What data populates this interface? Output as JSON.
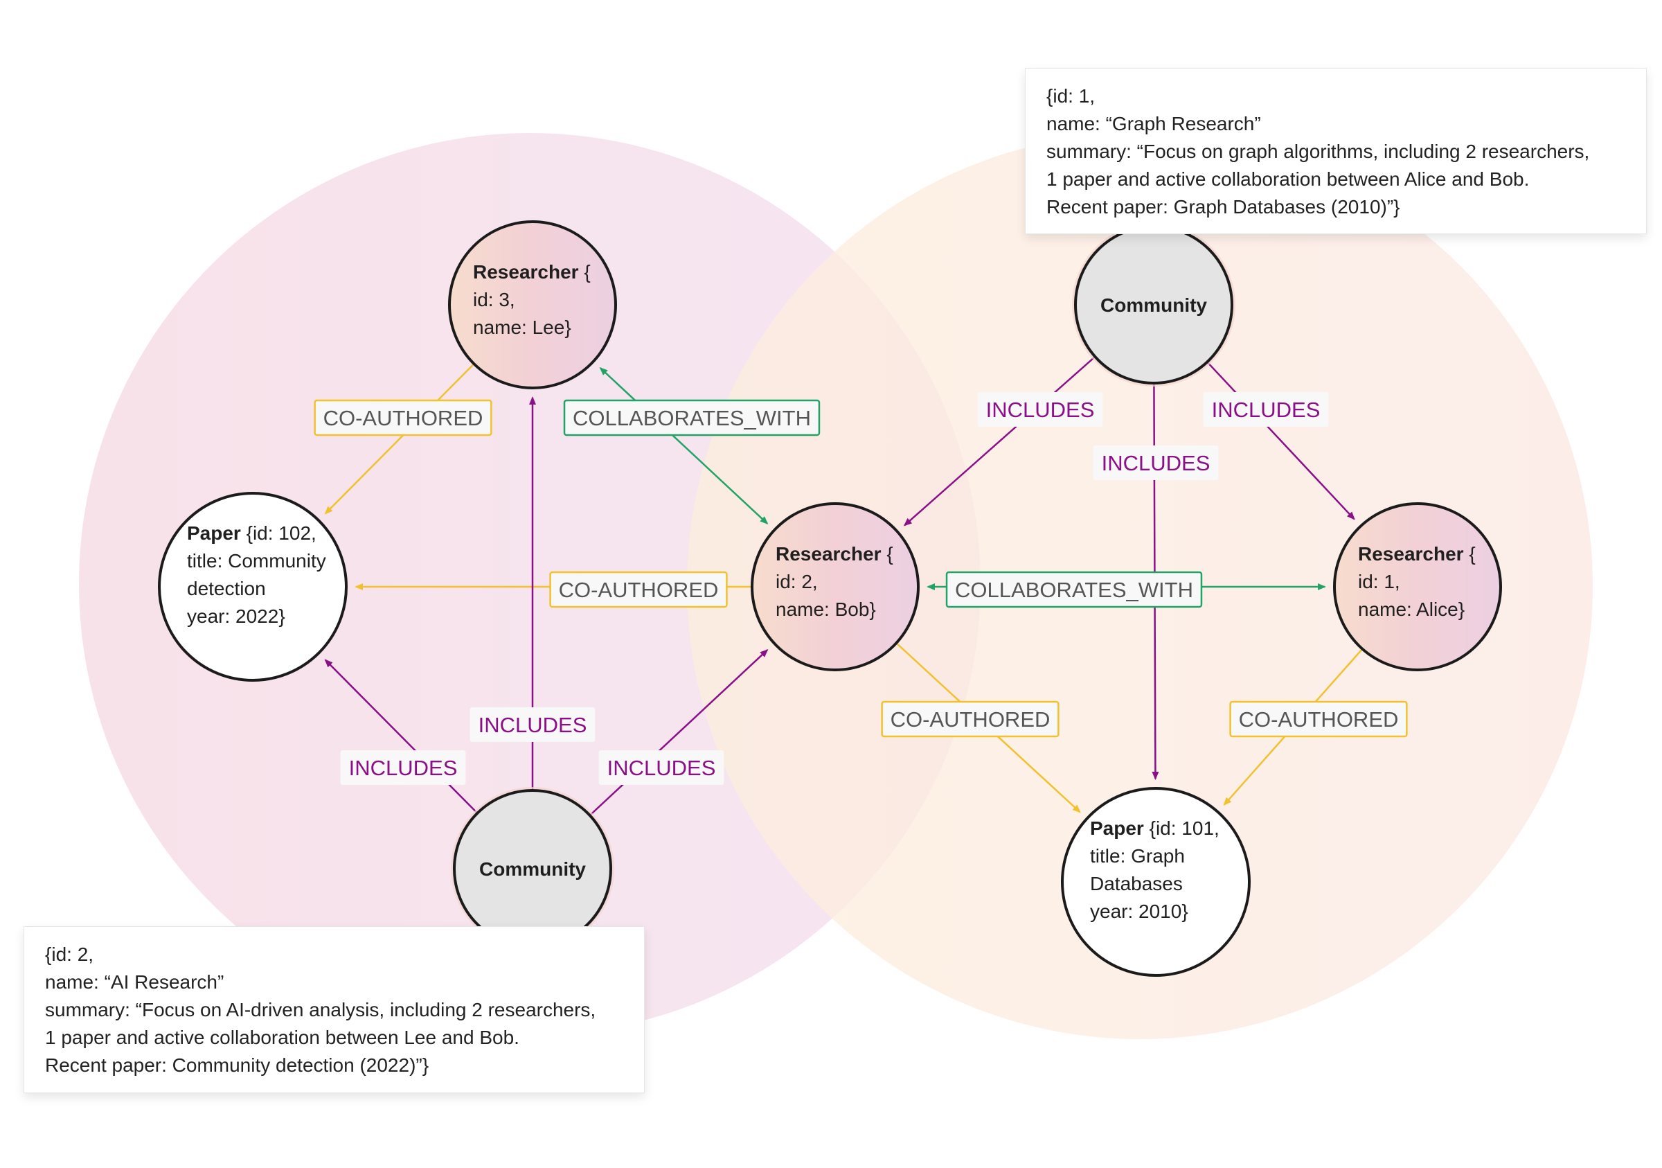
{
  "colors": {
    "includes": "#8b0f87",
    "co_authored": "#f2c12e",
    "collaborates_with": "#21a366",
    "node_stroke": "#1b1b1b",
    "community_fill": "#e4e4e4",
    "paper_fill": "#ffffff",
    "cluster_ai": "#f5d6e4",
    "cluster_graph": "#fde3cf",
    "label_text_gray": "#555555"
  },
  "clusters": [
    {
      "id": "ai",
      "name": "AI Research"
    },
    {
      "id": "graph",
      "name": "Graph Research"
    }
  ],
  "nodes": [
    {
      "id": "lee",
      "type": "researcher",
      "lines": [
        {
          "bold": "Researcher",
          "rest": " {"
        },
        {
          "bold": "",
          "rest": "id: 3,"
        },
        {
          "bold": "",
          "rest": "name: Lee}"
        }
      ]
    },
    {
      "id": "paper102",
      "type": "paper",
      "lines": [
        {
          "bold": "Paper",
          "rest": " {id: 102,"
        },
        {
          "bold": "",
          "rest": "title: Community"
        },
        {
          "bold": "",
          "rest": "detection"
        },
        {
          "bold": "",
          "rest": "year: 2022}"
        }
      ]
    },
    {
      "id": "bob",
      "type": "researcher",
      "lines": [
        {
          "bold": "Researcher",
          "rest": " {"
        },
        {
          "bold": "",
          "rest": "id: 2,"
        },
        {
          "bold": "",
          "rest": "name: Bob}"
        }
      ]
    },
    {
      "id": "community_ai",
      "type": "community",
      "lines": [
        {
          "bold": "Community",
          "rest": ""
        }
      ]
    },
    {
      "id": "community_graph",
      "type": "community",
      "lines": [
        {
          "bold": "Community",
          "rest": ""
        }
      ]
    },
    {
      "id": "alice",
      "type": "researcher",
      "lines": [
        {
          "bold": "Researcher",
          "rest": " {"
        },
        {
          "bold": "",
          "rest": "id: 1,"
        },
        {
          "bold": "",
          "rest": "name: Alice}"
        }
      ]
    },
    {
      "id": "paper101",
      "type": "paper",
      "lines": [
        {
          "bold": "Paper",
          "rest": " {id: 101,"
        },
        {
          "bold": "",
          "rest": "title: Graph"
        },
        {
          "bold": "",
          "rest": "Databases"
        },
        {
          "bold": "",
          "rest": "year: 2010}"
        }
      ]
    }
  ],
  "edges": [
    {
      "from": "lee",
      "to": "paper102",
      "label": "CO-AUTHORED",
      "kind": "co_authored"
    },
    {
      "from": "bob",
      "to": "lee",
      "label": "COLLABORATES_WITH",
      "kind": "collaborates_with",
      "bidirectional": true
    },
    {
      "from": "bob",
      "to": "paper102",
      "label": "CO-AUTHORED",
      "kind": "co_authored"
    },
    {
      "from": "community_ai",
      "to": "paper102",
      "label": "INCLUDES",
      "kind": "includes"
    },
    {
      "from": "community_ai",
      "to": "lee",
      "label": "INCLUDES",
      "kind": "includes"
    },
    {
      "from": "community_ai",
      "to": "bob",
      "label": "INCLUDES",
      "kind": "includes"
    },
    {
      "from": "community_graph",
      "to": "bob",
      "label": "INCLUDES",
      "kind": "includes"
    },
    {
      "from": "community_graph",
      "to": "paper101",
      "label": "INCLUDES",
      "kind": "includes"
    },
    {
      "from": "community_graph",
      "to": "alice",
      "label": "INCLUDES",
      "kind": "includes"
    },
    {
      "from": "alice",
      "to": "bob",
      "label": "COLLABORATES_WITH",
      "kind": "collaborates_with",
      "bidirectional": true
    },
    {
      "from": "bob",
      "to": "paper101",
      "label": "CO-AUTHORED",
      "kind": "co_authored"
    },
    {
      "from": "alice",
      "to": "paper101",
      "label": "CO-AUTHORED",
      "kind": "co_authored"
    }
  ],
  "tooltips": {
    "graph": {
      "lines": [
        "{id: 1,",
        "name: “Graph Research”",
        "summary: “Focus on graph algorithms, including 2 researchers,",
        "1 paper and active collaboration between Alice and Bob.",
        "Recent paper: Graph Databases (2010)”}"
      ]
    },
    "ai": {
      "lines": [
        "{id: 2,",
        "name: “AI Research”",
        "summary: “Focus on AI-driven analysis, including 2 researchers,",
        "1 paper and active collaboration between Lee and Bob.",
        "Recent paper: Community detection (2022)”}"
      ]
    }
  }
}
